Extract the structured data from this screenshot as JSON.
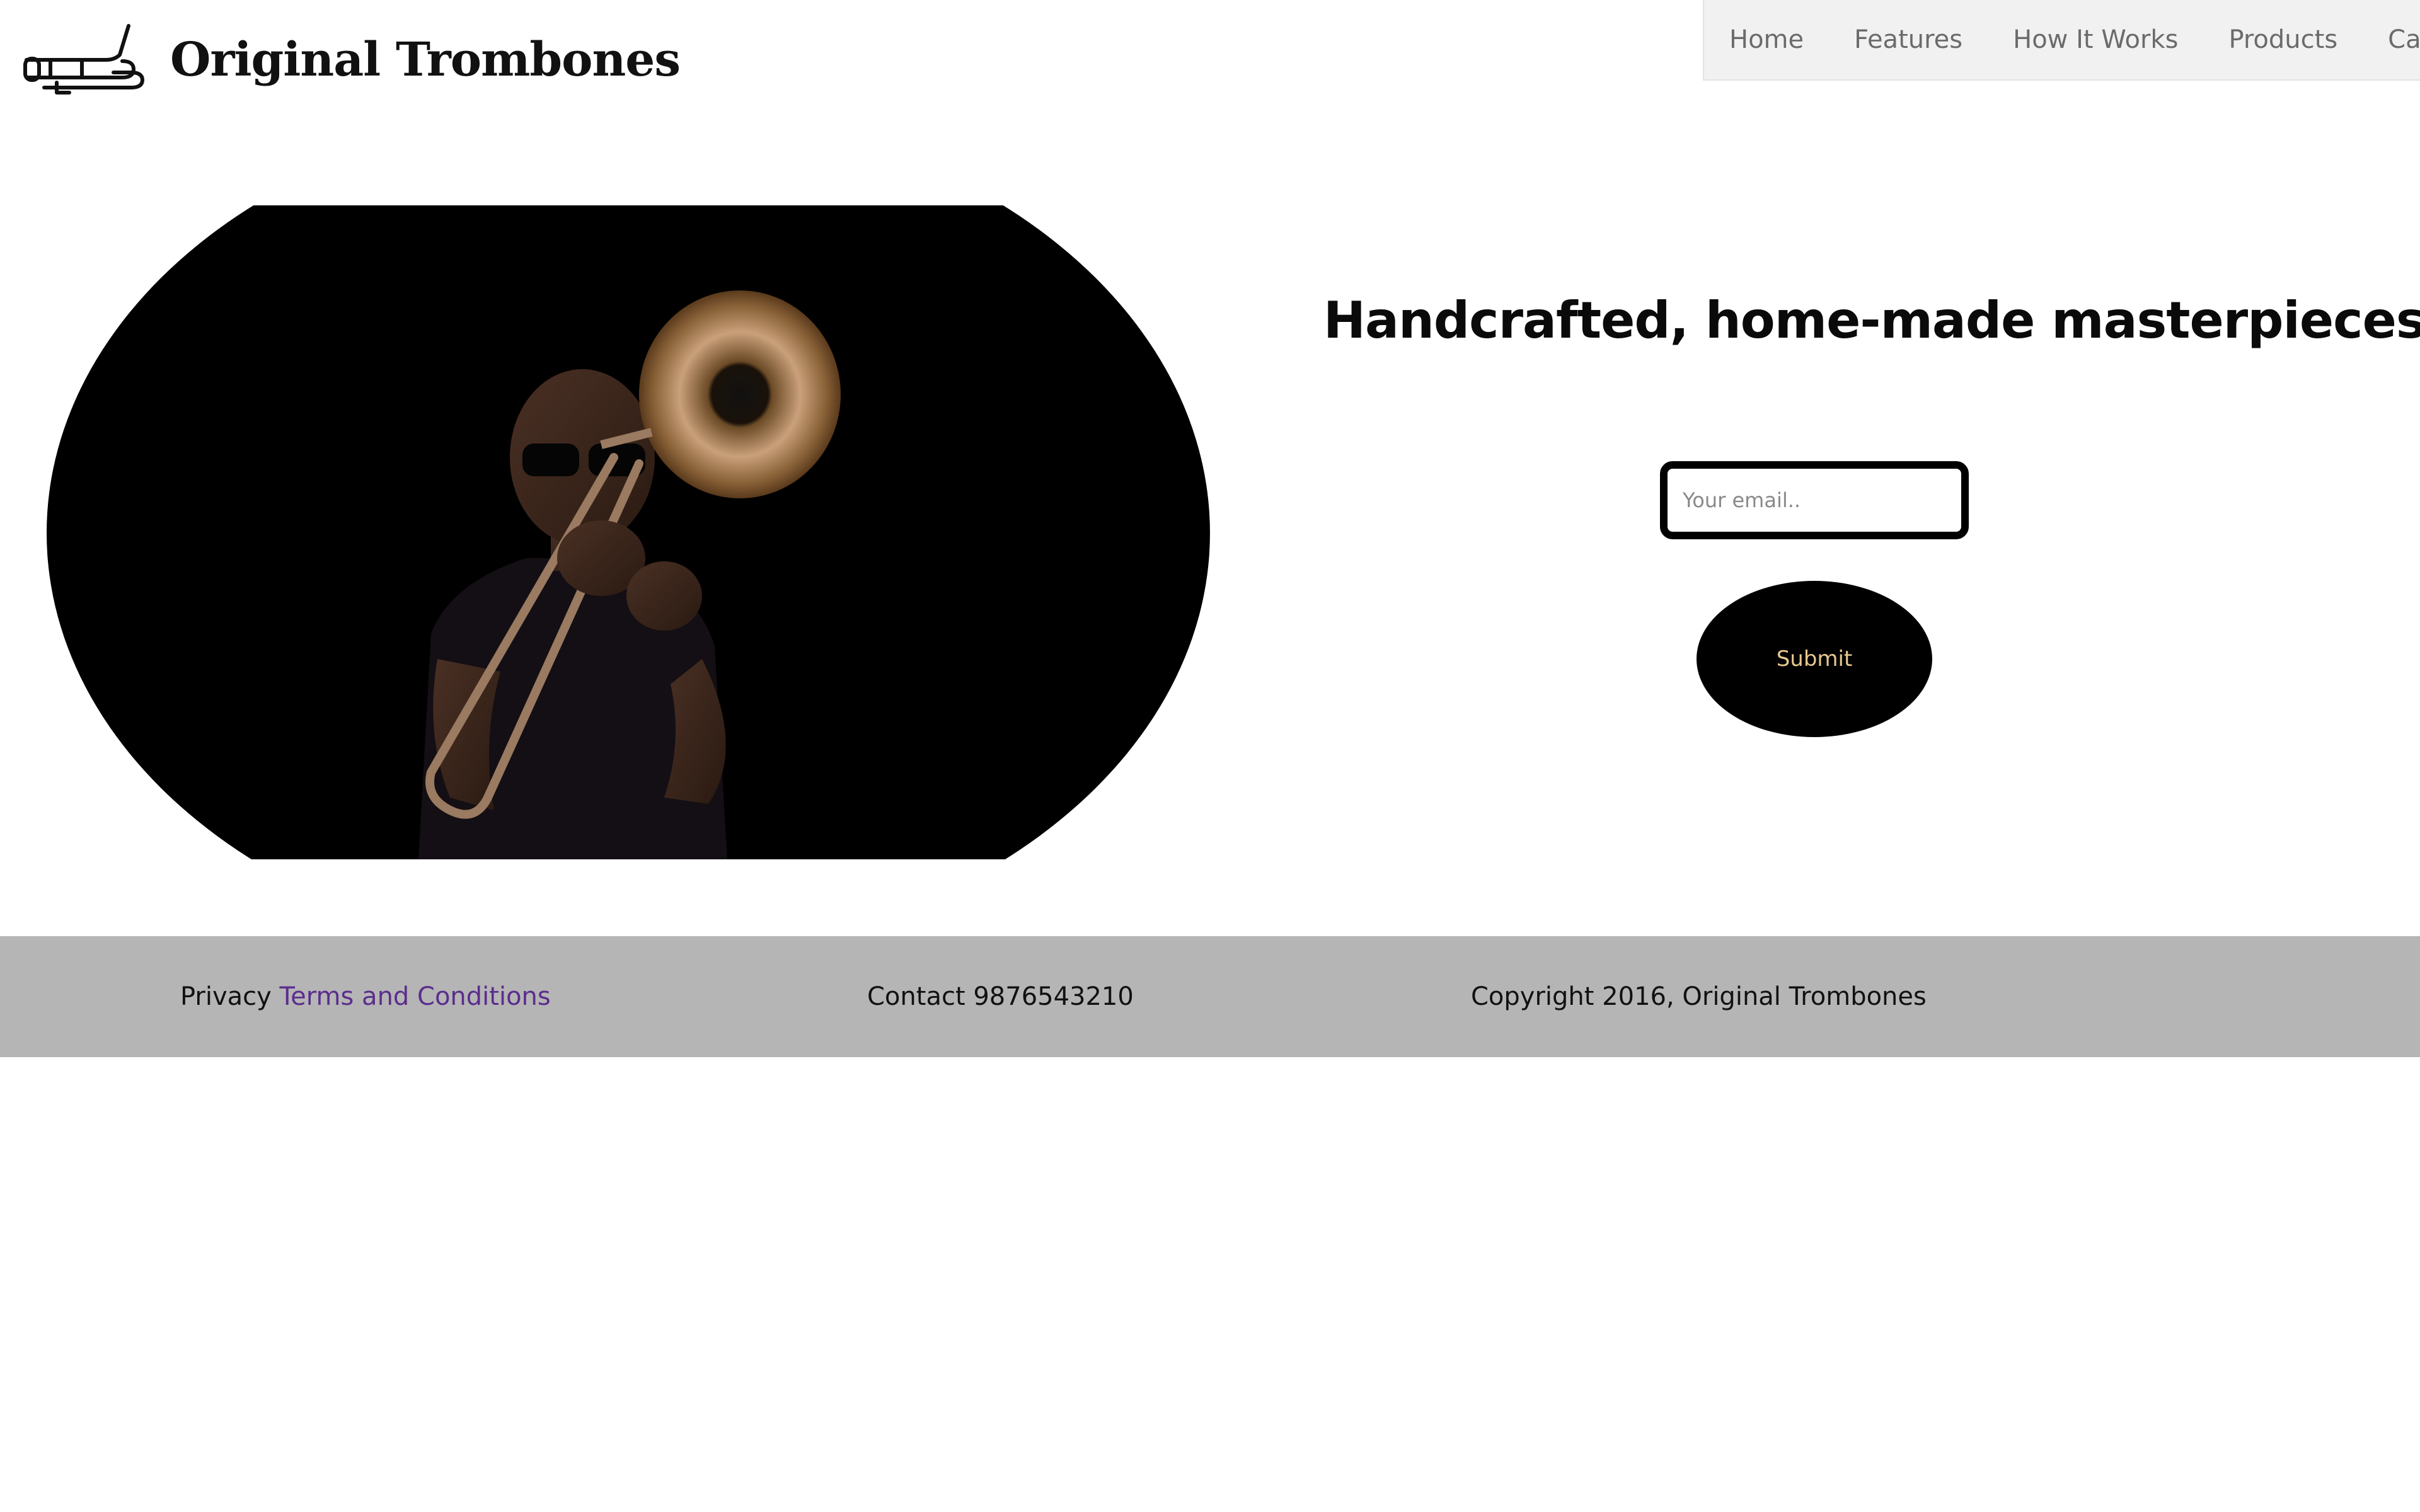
{
  "header": {
    "logo_icon": "trombone-icon",
    "brand": "Original Trombones"
  },
  "nav": {
    "items": [
      {
        "label": "Home"
      },
      {
        "label": "Features"
      },
      {
        "label": "How It Works"
      },
      {
        "label": "Products"
      },
      {
        "label": "Cart"
      }
    ]
  },
  "hero": {
    "headline": "Handcrafted, home-made masterpieces",
    "email_placeholder": "Your email..",
    "email_value": "",
    "submit_label": "Submit"
  },
  "footer": {
    "privacy_label": "Privacy",
    "terms_label": "Terms and Conditions",
    "contact_label": "Contact 9876543210",
    "copyright": "Copyright 2016, Original Trombones"
  },
  "colors": {
    "nav_background": "#f1f1f1",
    "footer_background": "#b5b5b5",
    "link": "#5b2d8e",
    "submit_text": "#e6c88f",
    "hero_background": "#000000"
  }
}
